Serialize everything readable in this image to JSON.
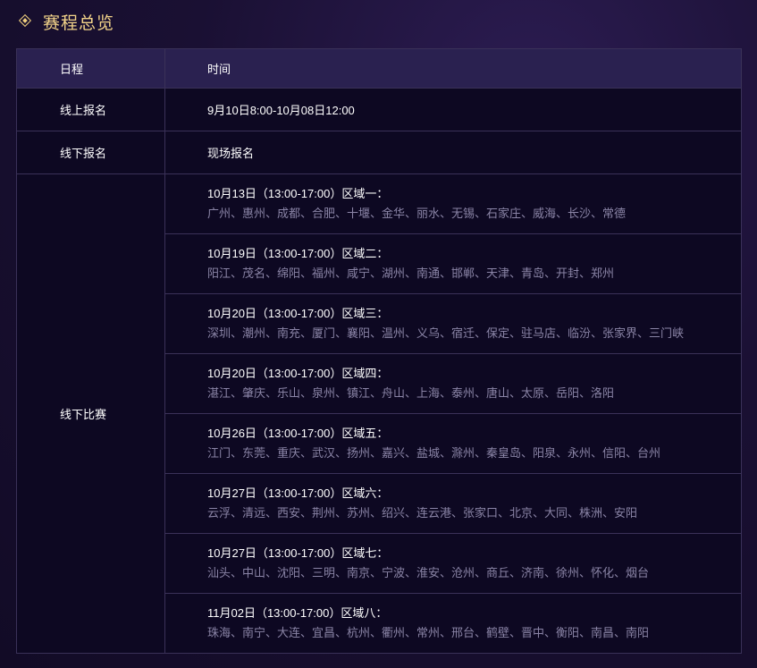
{
  "title": "赛程总览",
  "table": {
    "headers": [
      "日程",
      "时间"
    ],
    "rows": [
      {
        "label": "线上报名",
        "value": "9月10日8:00-10月08日12:00"
      },
      {
        "label": "线下报名",
        "value": "现场报名"
      }
    ],
    "offline_label": "线下比赛",
    "regions": [
      {
        "head": "10月13日（13:00-17:00）区域一：",
        "cities": "广州、惠州、成都、合肥、十堰、金华、丽水、无锡、石家庄、威海、长沙、常德"
      },
      {
        "head": "10月19日（13:00-17:00）区域二：",
        "cities": "阳江、茂名、绵阳、福州、咸宁、湖州、南通、邯郸、天津、青岛、开封、郑州"
      },
      {
        "head": "10月20日（13:00-17:00）区域三：",
        "cities": "深圳、潮州、南充、厦门、襄阳、温州、义乌、宿迁、保定、驻马店、临汾、张家界、三门峡"
      },
      {
        "head": "10月20日（13:00-17:00）区域四：",
        "cities": "湛江、肇庆、乐山、泉州、镇江、舟山、上海、泰州、唐山、太原、岳阳、洛阳"
      },
      {
        "head": "10月26日（13:00-17:00）区域五：",
        "cities": "江门、东莞、重庆、武汉、扬州、嘉兴、盐城、滁州、秦皇岛、阳泉、永州、信阳、台州"
      },
      {
        "head": "10月27日（13:00-17:00）区域六：",
        "cities": "云浮、清远、西安、荆州、苏州、绍兴、连云港、张家口、北京、大同、株洲、安阳"
      },
      {
        "head": "10月27日（13:00-17:00）区域七：",
        "cities": "汕头、中山、沈阳、三明、南京、宁波、淮安、沧州、商丘、济南、徐州、怀化、烟台"
      },
      {
        "head": "11月02日（13:00-17:00）区域八：",
        "cities": "珠海、南宁、大连、宜昌、杭州、衢州、常州、邢台、鹤壁、晋中、衡阳、南昌、南阳"
      }
    ]
  }
}
